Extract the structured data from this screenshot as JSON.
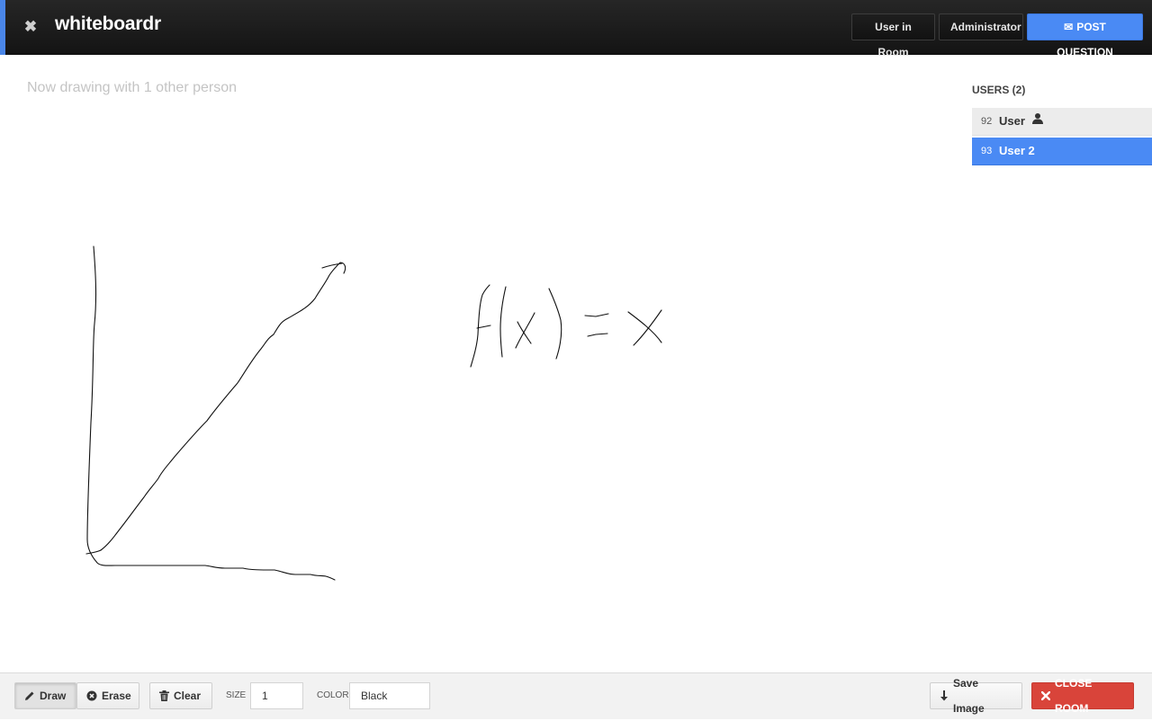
{
  "header": {
    "close_glyph": "✖",
    "title": "whiteboardr",
    "buttons": {
      "user_in_room": "User in Room",
      "administrator": "Administrator",
      "post_question": "POST QUESTION"
    },
    "accent_color": "#4a86e8"
  },
  "status_text": "Now drawing with 1 other person",
  "users": {
    "heading": "USERS (2)",
    "list": [
      {
        "id": "92",
        "name": "User",
        "icon": "person-icon",
        "active": false
      },
      {
        "id": "93",
        "name": "User 2",
        "active": true
      }
    ],
    "active_color": "#4a8af4"
  },
  "toolbar": {
    "draw_label": "Draw",
    "erase_label": "Erase",
    "clear_label": "Clear",
    "size_label": "SIZE",
    "size_value": "1",
    "color_label": "COLOR",
    "color_value": "Black",
    "save_label": "Save Image",
    "close_room_label": "CLOSE ROOM",
    "danger_color": "#d9443a"
  },
  "icons": [
    "close-icon",
    "envelope-icon",
    "person-icon",
    "pencil-icon",
    "erase-icon",
    "trash-icon",
    "download-icon",
    "x-icon"
  ]
}
